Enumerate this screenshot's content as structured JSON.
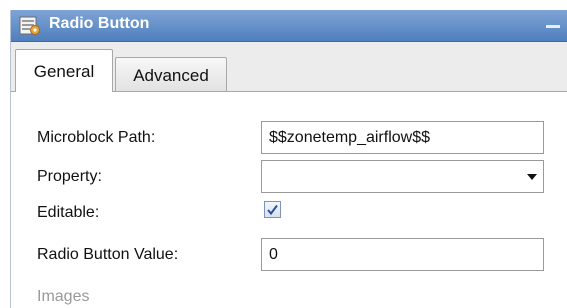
{
  "panel": {
    "title": "Radio Button",
    "title_icon": "form-properties-icon",
    "minimize_icon": "minimize-icon"
  },
  "tabs": [
    {
      "label": "General",
      "active": true
    },
    {
      "label": "Advanced",
      "active": false
    }
  ],
  "form": {
    "microblock_path": {
      "label": "Microblock Path:",
      "value": "$$zonetemp_airflow$$"
    },
    "property": {
      "label": "Property:",
      "value": ""
    },
    "editable": {
      "label": "Editable:",
      "checked": true
    },
    "radio_button_value": {
      "label": "Radio Button Value:",
      "value": "0"
    }
  },
  "section_partial": {
    "label": "Images"
  },
  "colors": {
    "titlebar": "#5b86c4",
    "tabstrip": "#ececec",
    "check": "#2b4f9c"
  }
}
